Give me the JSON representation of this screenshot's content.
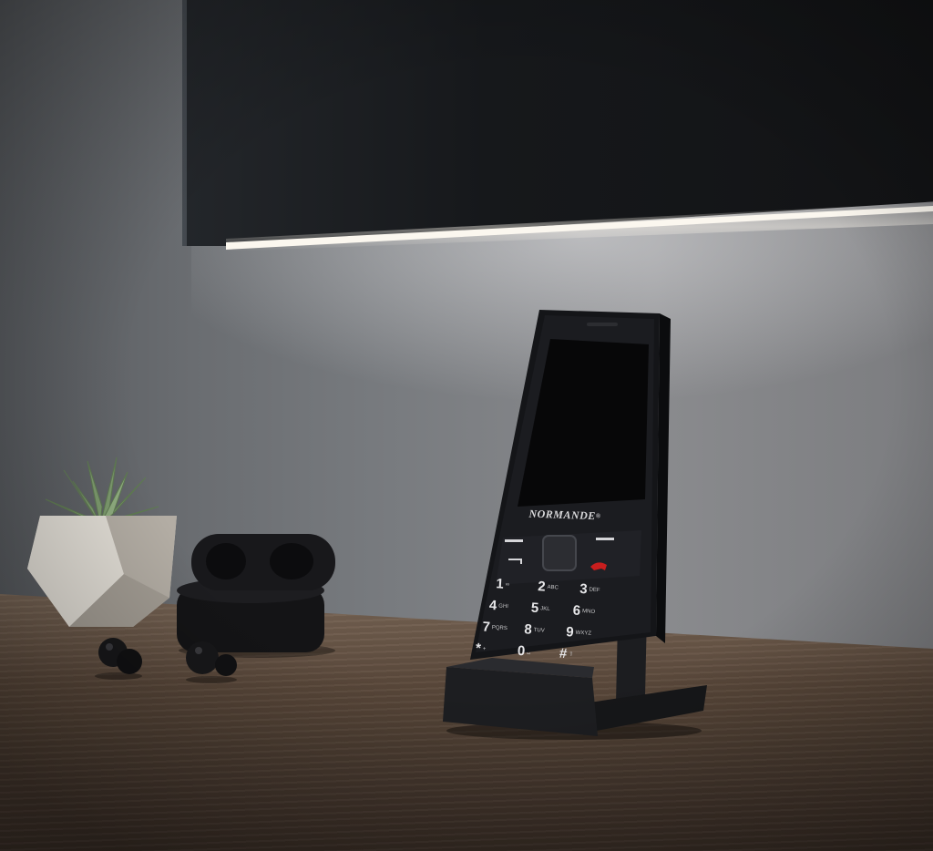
{
  "photo": {
    "brand_name": "NORMANDE",
    "brand_mark": "®",
    "keypad": [
      {
        "digit": "1",
        "letters": "∞"
      },
      {
        "digit": "2",
        "letters": "ABC"
      },
      {
        "digit": "3",
        "letters": "DEF"
      },
      {
        "digit": "4",
        "letters": "GHI"
      },
      {
        "digit": "5",
        "letters": "JKL"
      },
      {
        "digit": "6",
        "letters": "MNO"
      },
      {
        "digit": "7",
        "letters": "PQRS"
      },
      {
        "digit": "8",
        "letters": "TUV"
      },
      {
        "digit": "9",
        "letters": "WXYZ"
      },
      {
        "digit": "*",
        "letters": "+"
      },
      {
        "digit": "0",
        "letters": "␣"
      },
      {
        "digit": "#",
        "letters": "⇧"
      }
    ],
    "colors": {
      "led_light": "#f4efe6",
      "phone_body": "#141518",
      "end_call_key": "#c81e1e",
      "desk_wood": "#5c4a3c"
    }
  }
}
